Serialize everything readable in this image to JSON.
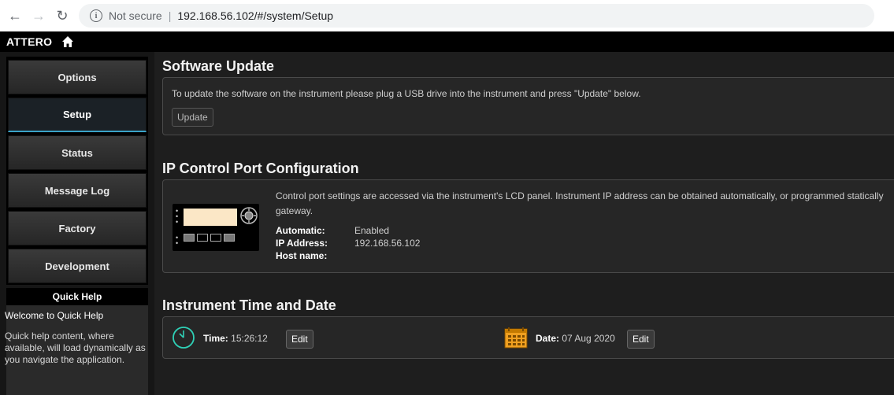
{
  "browser": {
    "security_label": "Not secure",
    "url": "192.168.56.102/#/system/Setup"
  },
  "app": {
    "brand": "ATTERO"
  },
  "sidebar": {
    "items": [
      {
        "label": "Options",
        "active": false
      },
      {
        "label": "Setup",
        "active": true
      },
      {
        "label": "Status",
        "active": false
      },
      {
        "label": "Message Log",
        "active": false
      },
      {
        "label": "Factory",
        "active": false
      },
      {
        "label": "Development",
        "active": false
      }
    ],
    "quick_help": {
      "title": "Quick Help",
      "welcome": "Welcome to Quick Help",
      "body": "Quick help content, where available, will load dynamically as you navigate the application."
    }
  },
  "software_update": {
    "title": "Software Update",
    "description": "To update the software on the instrument please plug a USB drive into the instrument and press \"Update\" below.",
    "button": "Update"
  },
  "ip_config": {
    "title": "IP Control Port Configuration",
    "description": "Control port settings are accessed via the instrument's LCD panel. Instrument IP address can be obtained automatically, or programmed statically gateway.",
    "fields": {
      "automatic_label": "Automatic:",
      "automatic_value": "Enabled",
      "ip_label": "IP Address:",
      "ip_value": "192.168.56.102",
      "host_label": "Host name:",
      "host_value": ""
    }
  },
  "time_date": {
    "title": "Instrument Time and Date",
    "time_label": "Time:",
    "time_value": "15:26:12",
    "date_label": "Date:",
    "date_value": "07 Aug 2020",
    "edit_label": "Edit"
  },
  "colors": {
    "accent": "#3aa3c8",
    "clock": "#2fd0b6",
    "calendar": "#f0a020"
  }
}
